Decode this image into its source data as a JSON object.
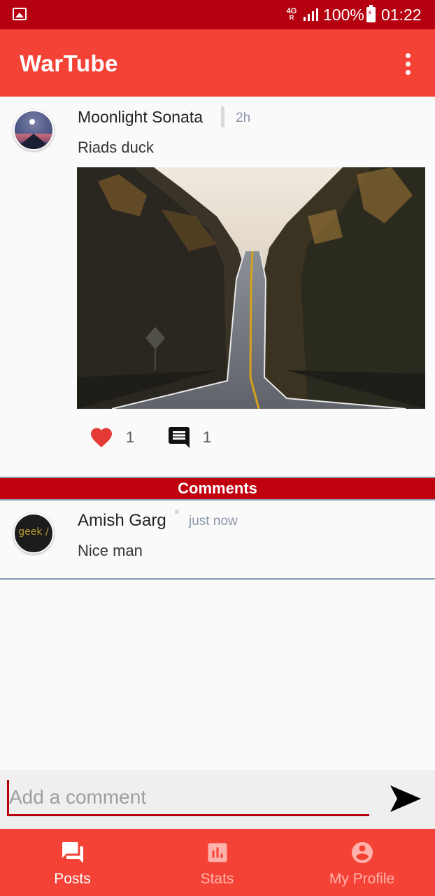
{
  "status_bar": {
    "network": "4G",
    "network_sub": "R",
    "battery": "100%",
    "time": "01:22"
  },
  "app_bar": {
    "title": "WarTube",
    "menu_icon": "more-vert-icon"
  },
  "post": {
    "author": "Moonlight Sonata",
    "time": "2h",
    "text": "Riads duck",
    "likes": "1",
    "comments": "1"
  },
  "comments": {
    "header": "Comments",
    "items": [
      {
        "author": "Amish Garg",
        "time": "just now",
        "text": "Nice man",
        "avatar_text": "geek /"
      }
    ]
  },
  "comment_input": {
    "placeholder": "Add a comment",
    "value": ""
  },
  "bottom_nav": {
    "items": [
      {
        "label": "Posts",
        "icon": "forum-icon",
        "active": true
      },
      {
        "label": "Stats",
        "icon": "bar-chart-icon",
        "active": false
      },
      {
        "label": "My Profile",
        "icon": "account-circle-icon",
        "active": false
      }
    ]
  },
  "colors": {
    "status_bar": "#b5000f",
    "app_bar": "#f44336",
    "comments_header": "#c0000f",
    "like": "#e53935"
  }
}
